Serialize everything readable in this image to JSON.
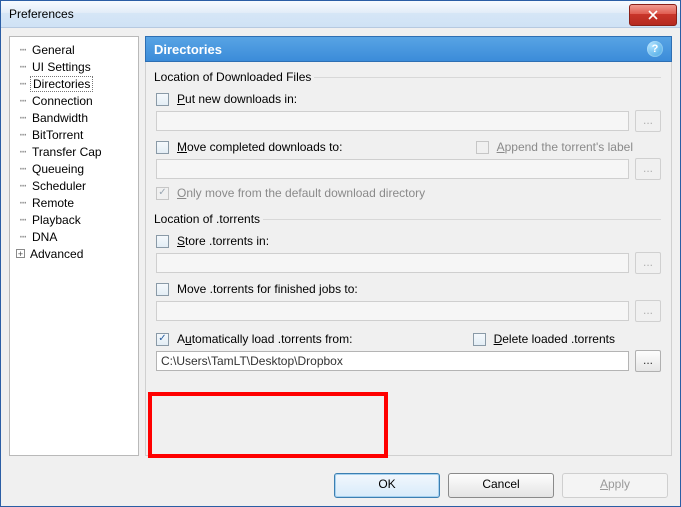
{
  "window": {
    "title": "Preferences"
  },
  "sidebar": {
    "items": [
      {
        "label": "General"
      },
      {
        "label": "UI Settings"
      },
      {
        "label": "Directories",
        "selected": true
      },
      {
        "label": "Connection"
      },
      {
        "label": "Bandwidth"
      },
      {
        "label": "BitTorrent"
      },
      {
        "label": "Transfer Cap"
      },
      {
        "label": "Queueing"
      },
      {
        "label": "Scheduler"
      },
      {
        "label": "Remote"
      },
      {
        "label": "Playback"
      },
      {
        "label": "DNA"
      },
      {
        "label": "Advanced",
        "expandable": true
      }
    ]
  },
  "panel": {
    "title": "Directories",
    "sections": {
      "downloaded": {
        "legend": "Location of Downloaded Files",
        "put_new": {
          "label": "Put new downloads in:",
          "checked": false,
          "path": ""
        },
        "move_completed": {
          "label": "Move completed downloads to:",
          "checked": false,
          "path": ""
        },
        "append_label": {
          "label": "Append the torrent's label",
          "checked": false
        },
        "only_move": {
          "label": "Only move from the default download directory",
          "checked": true,
          "disabled": true
        }
      },
      "torrents": {
        "legend": "Location of .torrents",
        "store": {
          "label": "Store .torrents in:",
          "checked": false,
          "path": ""
        },
        "move_finished": {
          "label": "Move .torrents for finished jobs to:",
          "checked": false,
          "path": ""
        },
        "autoload": {
          "label": "Automatically load .torrents from:",
          "checked": true,
          "path": "C:\\Users\\TamLT\\Desktop\\Dropbox"
        },
        "delete_loaded": {
          "label": "Delete loaded .torrents",
          "checked": false
        }
      }
    }
  },
  "footer": {
    "ok": "OK",
    "cancel": "Cancel",
    "apply": "Apply"
  }
}
